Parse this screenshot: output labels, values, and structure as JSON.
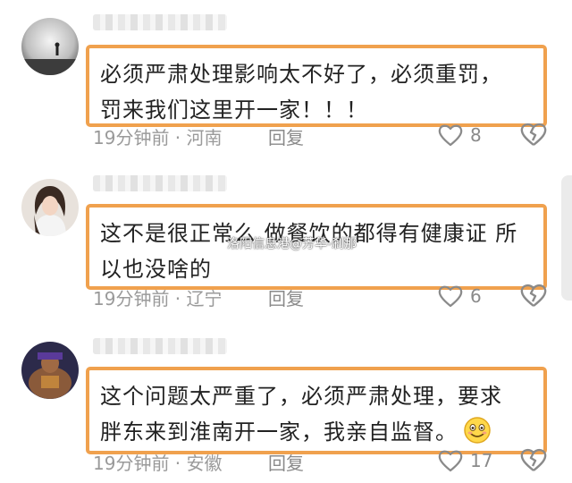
{
  "comments": [
    {
      "text_line1": "必须严肃处理影响太不好了，必须重罚，",
      "text_line2": "罚来我们这里开一家！！！",
      "time": "19分钟前",
      "location": "河南",
      "reply": "回复",
      "likes": "8"
    },
    {
      "text_line1": "这不是很正常么 做餐饮的都得有健康证 所",
      "text_line2": "以也没啥的",
      "time": "19分钟前",
      "location": "辽宁",
      "reply": "回复",
      "likes": "6"
    },
    {
      "text_line1": "这个问题太严重了，必须严肃处理，要求",
      "text_line2": "胖东来到淮南开一家，我亲自监督。",
      "time": "19分钟前",
      "location": "安徽",
      "reply": "回复",
      "likes": "17"
    }
  ],
  "watermark": "洛阳信息港@芳华-剎那",
  "icons": [
    "heart-icon",
    "broken-heart-icon",
    "smile-emoji-icon"
  ],
  "colors": {
    "bubble_border": "#f0a14e",
    "meta_text": "#9a9a9a"
  }
}
